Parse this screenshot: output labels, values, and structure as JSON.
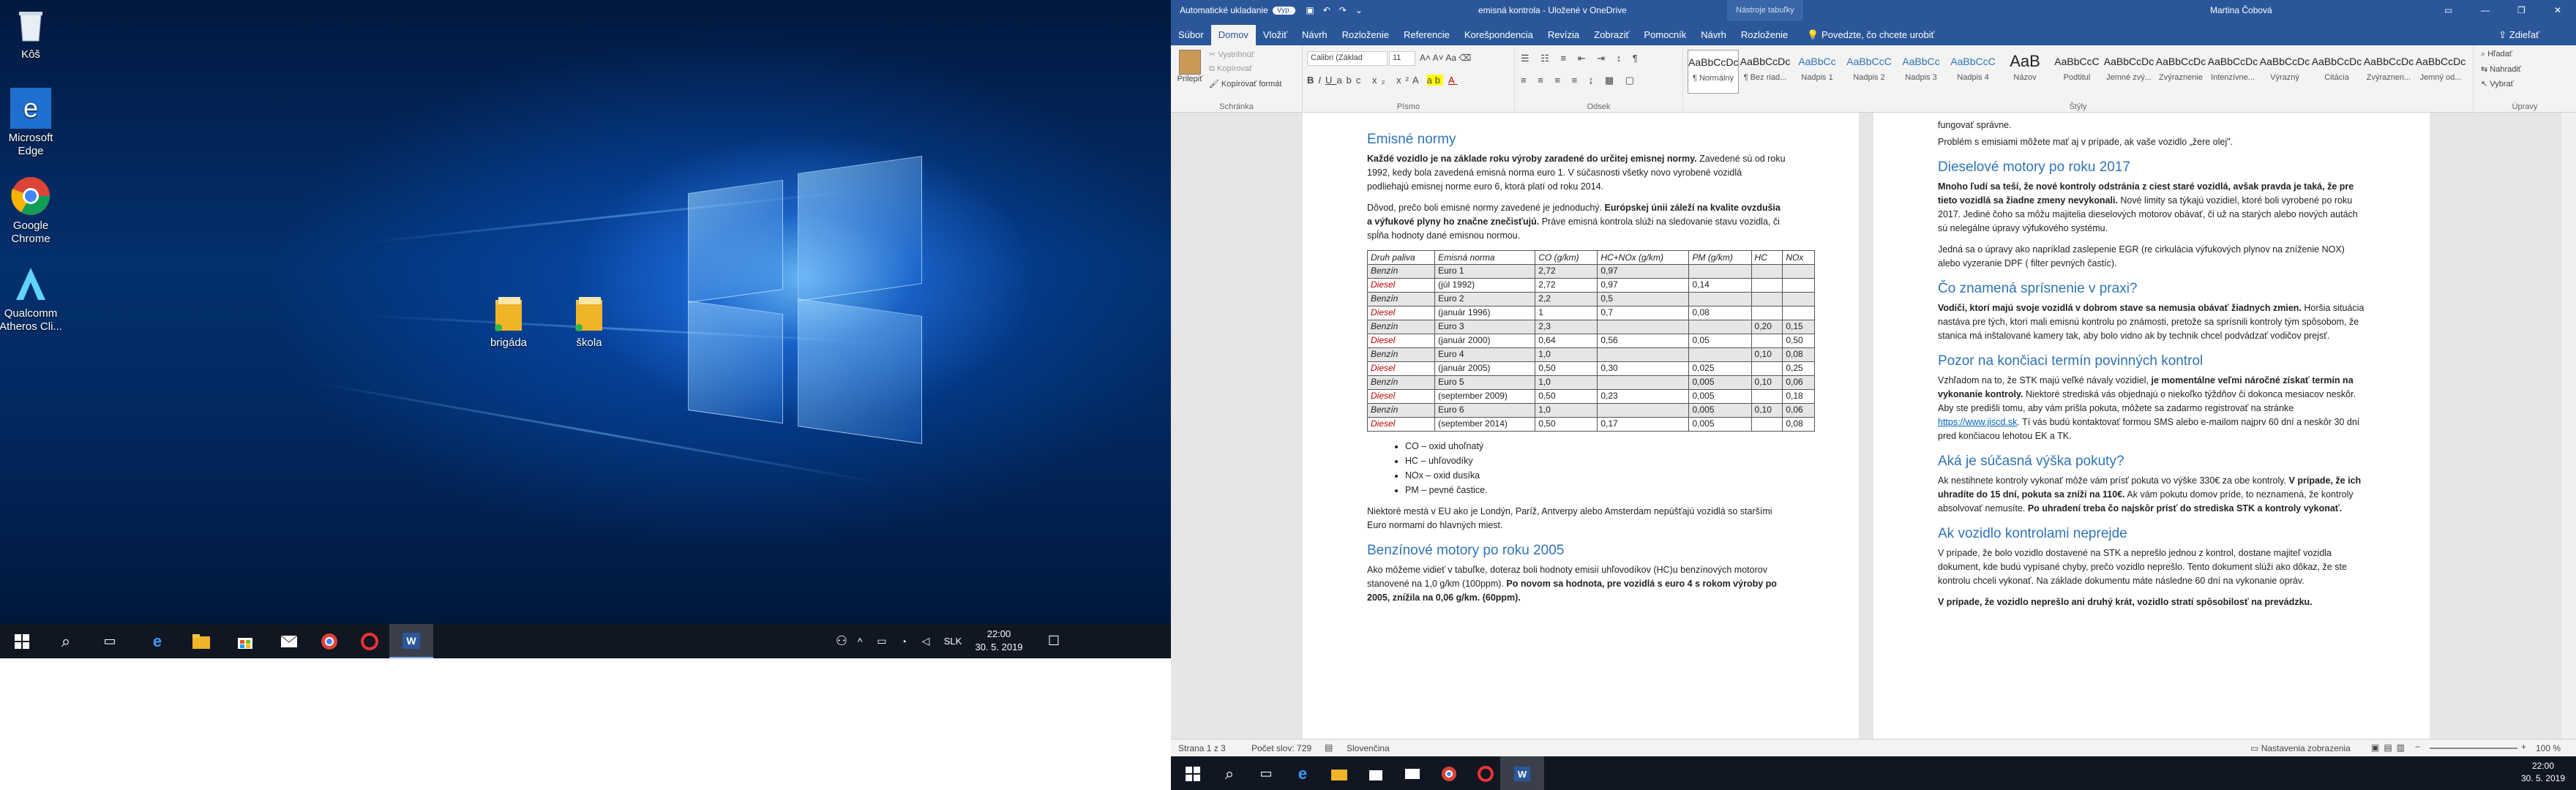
{
  "desktop": {
    "icons": [
      {
        "label": "Kôš",
        "name": "recycle-bin-icon"
      },
      {
        "label": "Microsoft Edge",
        "name": "edge-icon"
      },
      {
        "label": "Google Chrome",
        "name": "chrome-icon"
      },
      {
        "label": "Qualcomm Atheros Cli...",
        "name": "atheros-icon"
      },
      {
        "label": "brigáda",
        "name": "folder-icon"
      },
      {
        "label": "škola",
        "name": "folder-icon"
      }
    ]
  },
  "left_taskbar": {
    "lang": "SLK",
    "time": "22:00",
    "date": "30. 5. 2019"
  },
  "word": {
    "title_left": "Automatické ukladanie",
    "autosave": "Vyp.",
    "title": "emisná kontrola - Uložené v OneDrive",
    "context": "Nástroje tabuľky",
    "user": "Martina Čobová",
    "tabs": [
      "Súbor",
      "Domov",
      "Vložiť",
      "Návrh",
      "Rozloženie",
      "Referencie",
      "Korešpondencia",
      "Revízia",
      "Zobraziť",
      "Pomocník",
      "Návrh",
      "Rozloženie"
    ],
    "tell": "Povedzte, čo chcete urobiť",
    "share": "Zdieľať",
    "ribbon": {
      "paste": "Prilepiť",
      "cut": "Vystrihnúť",
      "copy": "Kopírovať",
      "format": "Kopírovať formát",
      "clipboard": "Schránka",
      "font_name": "Calibri (Základ",
      "font_size": "11",
      "font": "Písmo",
      "paragraph": "Odsek",
      "styles_label": "Štýly",
      "editing": "Úpravy",
      "find": "Hľadať",
      "replace": "Nahradiť",
      "select": "Vybrať",
      "styles": [
        {
          "prev": "AaBbCcDc",
          "name": "¶ Normálny"
        },
        {
          "prev": "AaBbCcDc",
          "name": "¶ Bez riad..."
        },
        {
          "prev": "AaBbCc",
          "name": "Nadpis 1"
        },
        {
          "prev": "AaBbCcC",
          "name": "Nadpis 2"
        },
        {
          "prev": "AaBbCc",
          "name": "Nadpis 3"
        },
        {
          "prev": "AaBbCcC",
          "name": "Nadpis 4"
        },
        {
          "prev": "AaB",
          "name": "Názov"
        },
        {
          "prev": "AaBbCcC",
          "name": "Podtitul"
        },
        {
          "prev": "AaBbCcDc",
          "name": "Jemné zvý..."
        },
        {
          "prev": "AaBbCcDc",
          "name": "Zvýraznenie"
        },
        {
          "prev": "AaBbCcDc",
          "name": "Intenzívne..."
        },
        {
          "prev": "AaBbCcDc",
          "name": "Výrazný"
        },
        {
          "prev": "AaBbCcDc",
          "name": "Citácia"
        },
        {
          "prev": "AaBbCcDc",
          "name": "Zvýraznen..."
        },
        {
          "prev": "AaBbCcDc",
          "name": "Jemný od..."
        }
      ]
    },
    "page1": {
      "h1": "Emisné normy",
      "p1_b": "Každé vozidlo je na základe roku výroby zaradené do určitej emisnej normy.",
      "p1": " Zavedené sú od roku 1992, kedy bola zavedená emisná norma euro 1. V súčasnosti všetky novo vyrobené vozidlá podliehajú emisnej norme euro 6, ktorá platí od roku 2014.",
      "p2": "Dôvod, prečo boli emisné normy zavedené je jednoduchý. ",
      "p2_b": "Európskej únii záleží na kvalite ovzdušia a výfukové plyny ho značne znečisťujú.",
      "p2_c": " Práve emisná kontrola slúži na sledovanie stavu vozidla, či spĺňa hodnoty dané emisnou normou.",
      "table": {
        "headers": [
          "Druh paliva",
          "Emisná norma",
          "CO (g/km)",
          "HC+NOx (g/km)",
          "PM (g/km)",
          "HC",
          "NOx"
        ],
        "rows": [
          [
            "Benzín",
            "Euro 1",
            "2,72",
            "0,97",
            "",
            "",
            ""
          ],
          [
            "Diesel",
            "(júl 1992)",
            "2,72",
            "0,97",
            "0,14",
            "",
            ""
          ],
          [
            "Benzín",
            "Euro 2",
            "2,2",
            "0,5",
            "",
            "",
            ""
          ],
          [
            "Diesel",
            "(január 1996)",
            "1",
            "0,7",
            "0,08",
            "",
            ""
          ],
          [
            "Benzín",
            "Euro 3",
            "2,3",
            "",
            "",
            "0,20",
            "0,15"
          ],
          [
            "Diesel",
            "(január 2000)",
            "0,64",
            "0,56",
            "0,05",
            "",
            "0,50"
          ],
          [
            "Benzín",
            "Euro 4",
            "1,0",
            "",
            "",
            "0,10",
            "0,08"
          ],
          [
            "Diesel",
            "(január 2005)",
            "0,50",
            "0,30",
            "0,025",
            "",
            "0,25"
          ],
          [
            "Benzín",
            "Euro 5",
            "1,0",
            "",
            "0,005",
            "0,10",
            "0,06"
          ],
          [
            "Diesel",
            "(september 2009)",
            "0,50",
            "0,23",
            "0,005",
            "",
            "0,18"
          ],
          [
            "Benzín",
            "Euro 6",
            "1,0",
            "",
            "0,005",
            "0,10",
            "0,06"
          ],
          [
            "Diesel",
            "(september 2014)",
            "0,50",
            "0,17",
            "0,005",
            "",
            "0,08"
          ]
        ]
      },
      "bullets": [
        "CO – oxid uhoľnatý",
        "HC – uhľovodíky",
        "NOx – oxid dusíka",
        "PM – pevné častice."
      ],
      "p3": "Niektoré mestá v EU ako je Londýn, Paríž, Antverpy alebo Amsterdam nepúšťajú vozidlá so staršími Euro normami do hlavných miest.",
      "h2": "Benzínové motory po roku 2005",
      "p4": "Ako môžeme vidieť v tabuľke, doteraz boli hodnoty emisií uhľovodíkov (HC)u benzínových motorov stanovené na 1,0 g/km (100ppm). ",
      "p4_b": "Po novom sa hodnota, pre vozidlá s euro 4 s rokom výroby po 2005, znížila na 0,06 g/km. (60ppm)."
    },
    "page2": {
      "p0": "fungovať správne.",
      "p0b": " Problém s emisiami môžete mať aj v prípade, ak vaše vozidlo „žere olej\".",
      "h1": "Dieselové motory po roku 2017",
      "p1_b": "Mnoho ľudí sa teší, že nové kontroly odstránia z ciest staré vozidlá, avšak pravda je taká, že pre tieto vozidlá sa žiadne zmeny nevykonali.",
      "p1": " Nové limity sa týkajú vozidiel, ktoré boli vyrobené po roku 2017. Jediné čoho sa môžu majitelia dieselových motorov obávať, či už na starých alebo nových autách sú nelegálne úpravy výfukového systému.",
      "p2": "Jedná sa o úpravy ako napríklad zaslepenie EGR (re cirkulácia výfukových plynov na zníženie NOX) alebo vyzeranie DPF ( filter pevných častíc).",
      "h2": "Čo znamená sprísnenie v praxi?",
      "p3_b": "Vodiči, ktorí majú svoje vozidlá v dobrom stave sa nemusia obávať žiadnych zmien.",
      "p3": " Horšia situácia nastáva pre tých, ktorí mali emisnú kontrolu po známosti, pretože sa sprísnili kontroly tým spôsobom, že stanica má inštalované kamery tak, aby bolo vidno ak by technik chcel podvádzať vodičov prejsť.",
      "h3": "Pozor na končiaci termín povinných kontrol",
      "p4": "Vzhľadom na to, že STK majú veľké návaly vozidiel, ",
      "p4_b": "je momentálne veľmi náročné získať termín na vykonanie kontroly.",
      "p4_c": " Niektoré strediská vás objednajú o niekoľko týždňov či dokonca mesiacov neskôr. Aby ste predišli tomu, aby vám prišla pokuta, môžete sa zadarmo registrovať na stránke ",
      "p4_link": "https://www.jiscd.sk",
      "p4_d": ". Tí vás budú kontaktovať formou SMS alebo e-mailom najprv 60 dní a neskôr 30 dní pred končiacou lehotou EK a TK.",
      "h4": "Aká je súčasná výška pokuty?",
      "p5": "Ak nestihnete kontroly vykonať môže vám prísť pokuta vo výške 330€ za obe kontroly. ",
      "p5_b": "V prípade, že ich uhradíte do 15 dní, pokuta sa zníži na 110€.",
      "p5_c": " Ak vám pokutu domov príde, to neznamená, že kontroly absolvovať nemusíte. ",
      "p5_d": "Po uhradení treba čo najskôr prísť do strediska STK a kontroly vykonať.",
      "h5": "Ak vozidlo kontrolami neprejde",
      "p6": "V prípade, že bolo vozidlo dostavené na STK a neprešlo jednou z kontrol, dostane majiteľ vozidla dokument, kde budú vypísané chyby, prečo vozidlo neprešlo. Tento dokument slúži ako dôkaz, že ste kontrolu chceli vykonať. Na základe dokumentu máte následne 60 dní na vykonanie opráv.",
      "p7_b": "V prípade, že vozidlo neprešlo ani druhý krát, vozidlo stratí spôsobilosť na prevádzku."
    },
    "status": {
      "page": "Strana 1 z 3",
      "words": "Počet slov: 729",
      "lang": "Slovenčina",
      "display": "Nastavenia zobrazenia",
      "zoom": "100 %"
    },
    "taskbar": {
      "time": "22:00",
      "date": "30. 5. 2019"
    }
  }
}
